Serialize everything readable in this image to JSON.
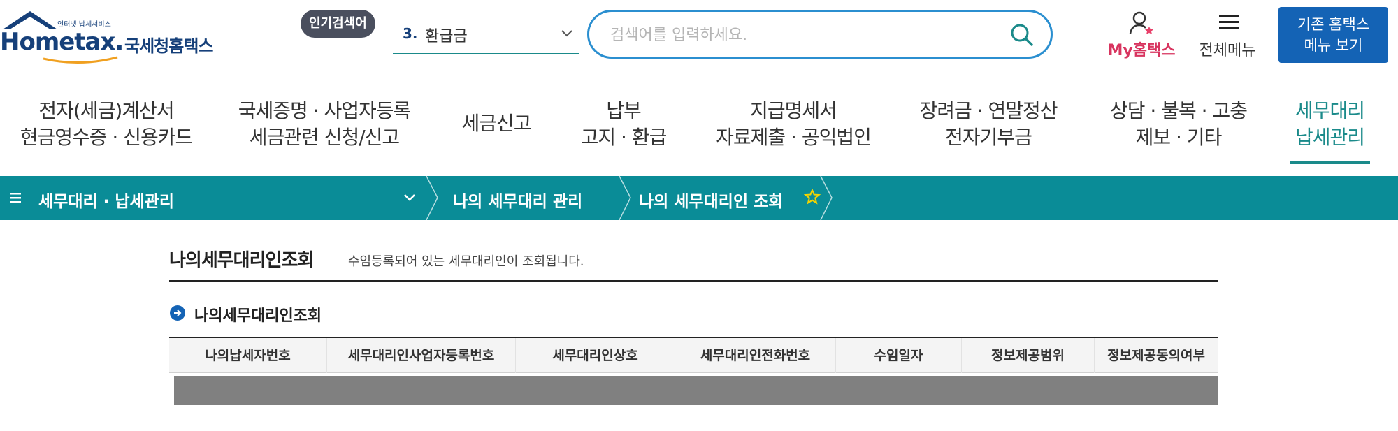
{
  "header": {
    "logo": {
      "tagline": "인터넷 납세서비스",
      "wordmark": "Hometax.",
      "korean_name": "국세청홈택스"
    },
    "popular_search": {
      "badge_label": "인기검색어",
      "rank": "3.",
      "term": "환급금"
    },
    "search": {
      "placeholder": "검색어를 입력하세요."
    },
    "my_hometax_label": "My홈택스",
    "all_menu_label": "전체메뉴",
    "legacy_button": {
      "line1": "기존 홈택스",
      "line2": "메뉴 보기"
    }
  },
  "main_nav": [
    {
      "line1": "전자(세금)계산서",
      "line2": "현금영수증 · 신용카드",
      "active": false
    },
    {
      "line1": "국세증명 · 사업자등록",
      "line2": "세금관련 신청/신고",
      "active": false
    },
    {
      "line1": "세금신고",
      "line2": "",
      "active": false
    },
    {
      "line1": "납부",
      "line2": "고지 · 환급",
      "active": false
    },
    {
      "line1": "지급명세서",
      "line2": "자료제출 · 공익법인",
      "active": false
    },
    {
      "line1": "장려금 · 연말정산",
      "line2": "전자기부금",
      "active": false
    },
    {
      "line1": "상담 · 불복 · 고충",
      "line2": "제보 · 기타",
      "active": false
    },
    {
      "line1": "세무대리",
      "line2": "납세관리",
      "active": true
    }
  ],
  "breadcrumb": {
    "section": "세무대리 · 납세관리",
    "items": [
      "나의 세무대리 관리",
      "나의 세무대리인 조회"
    ]
  },
  "page": {
    "title": "나의세무대리인조회",
    "description": "수임등록되어 있는 세무대리인이 조회됩니다.",
    "subsection_title": "나의세무대리인조회"
  },
  "table": {
    "columns": [
      "나의납세자번호",
      "세무대리인사업자등록번호",
      "세무대리인상호",
      "세무대리인전화번호",
      "수임일자",
      "정보제공범위",
      "정보제공동의여부"
    ],
    "rows": []
  },
  "colors": {
    "accent_teal": "#0a8c97",
    "brand_blue": "#16407a",
    "legacy_button_blue": "#1463b5",
    "my_hometax_pink": "#d8345f",
    "search_border": "#2b8fd0"
  }
}
